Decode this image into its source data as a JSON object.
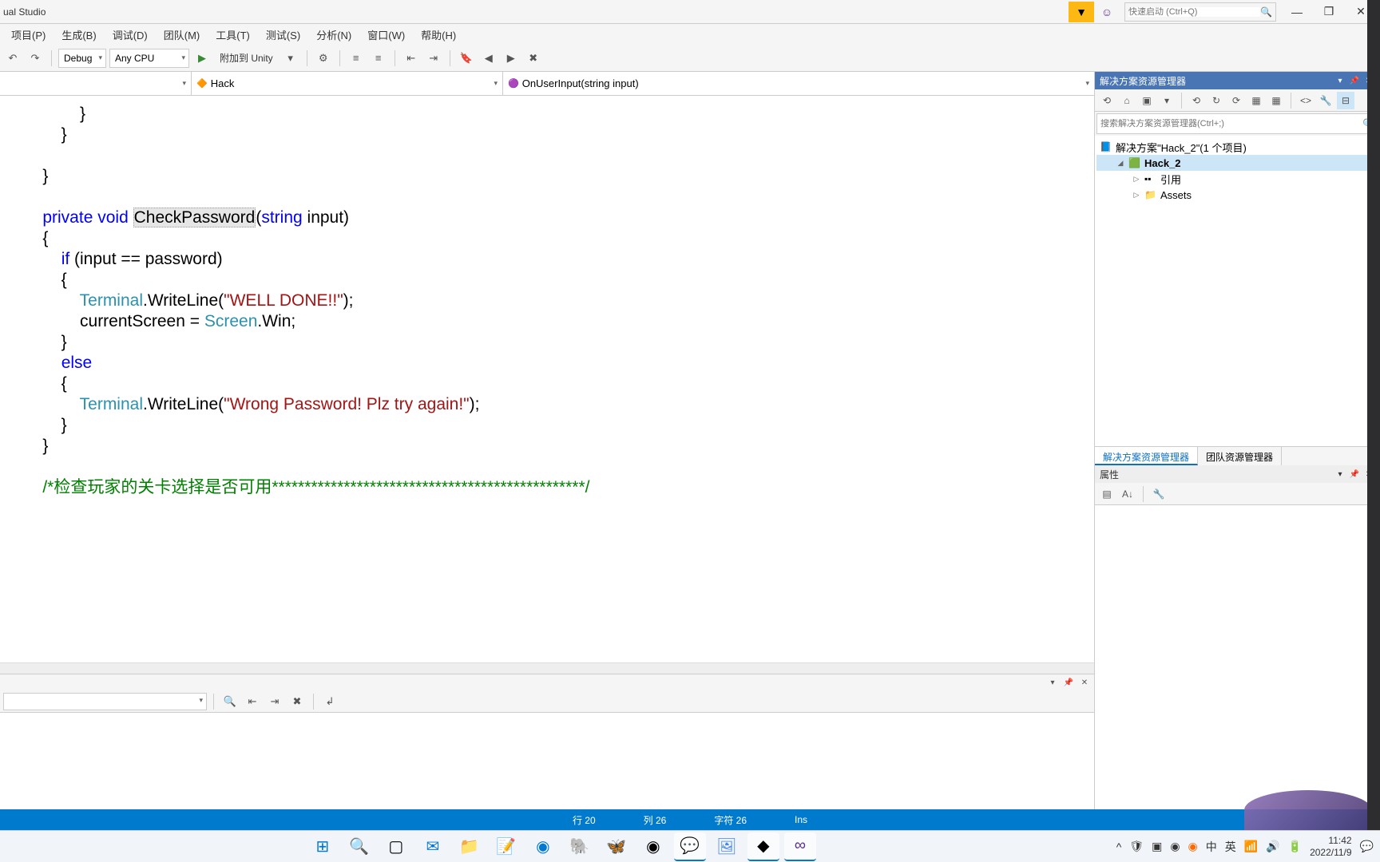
{
  "title": "ual Studio",
  "quicklaunch_placeholder": "快速启动 (Ctrl+Q)",
  "menu": [
    "项目(P)",
    "生成(B)",
    "调试(D)",
    "团队(M)",
    "工具(T)",
    "测试(S)",
    "分析(N)",
    "窗口(W)",
    "帮助(H)"
  ],
  "toolbar": {
    "config": "Debug",
    "platform": "Any CPU",
    "attach": "附加到 Unity"
  },
  "nav": {
    "scope": "",
    "class": "Hack",
    "member": "OnUserInput(string input)"
  },
  "code_lines": [
    {
      "t": "            }"
    },
    {
      "t": "        }"
    },
    {
      "t": ""
    },
    {
      "t": "    }"
    },
    {
      "t": ""
    },
    {
      "segs": [
        {
          "c": "kw",
          "t": "    private"
        },
        {
          "t": " "
        },
        {
          "c": "kw",
          "t": "void"
        },
        {
          "t": " "
        },
        {
          "c": "hl",
          "t": "CheckPassword"
        },
        {
          "t": "("
        },
        {
          "c": "kw",
          "t": "string"
        },
        {
          "t": " input)"
        }
      ]
    },
    {
      "t": "    {"
    },
    {
      "segs": [
        {
          "t": "        "
        },
        {
          "c": "kw",
          "t": "if"
        },
        {
          "t": " (input == password)"
        }
      ]
    },
    {
      "t": "        {"
    },
    {
      "segs": [
        {
          "t": "            "
        },
        {
          "c": "typ",
          "t": "Terminal"
        },
        {
          "t": ".WriteLine("
        },
        {
          "c": "str",
          "t": "\"WELL DONE!!\""
        },
        {
          "t": ");"
        }
      ]
    },
    {
      "segs": [
        {
          "t": "            currentScreen = "
        },
        {
          "c": "typ",
          "t": "Screen"
        },
        {
          "t": ".Win;"
        }
      ]
    },
    {
      "t": "        }"
    },
    {
      "segs": [
        {
          "t": "        "
        },
        {
          "c": "kw",
          "t": "else"
        }
      ]
    },
    {
      "t": "        {"
    },
    {
      "segs": [
        {
          "t": "            "
        },
        {
          "c": "typ",
          "t": "Terminal"
        },
        {
          "t": ".WriteLine("
        },
        {
          "c": "str",
          "t": "\"Wrong Password! Plz try again!\""
        },
        {
          "t": ");"
        }
      ]
    },
    {
      "t": "        }"
    },
    {
      "t": "    }"
    },
    {
      "t": ""
    },
    {
      "segs": [
        {
          "t": "    "
        },
        {
          "c": "cmt",
          "t": "/*检查玩家的关卡选择是否可用************************************************/"
        }
      ]
    }
  ],
  "solution_explorer": {
    "title": "解决方案资源管理器",
    "search_placeholder": "搜索解决方案资源管理器(Ctrl+;)",
    "solution": "解决方案\"Hack_2\"(1 个项目)",
    "project": "Hack_2",
    "nodes": [
      "引用",
      "Assets"
    ],
    "tab1": "解决方案资源管理器",
    "tab2": "团队资源管理器"
  },
  "properties": {
    "title": "属性"
  },
  "status": {
    "line": "行 20",
    "col": "列 26",
    "char": "字符 26",
    "ins": "Ins"
  },
  "tray": {
    "time": "11:42",
    "date": "2022/11/9"
  }
}
